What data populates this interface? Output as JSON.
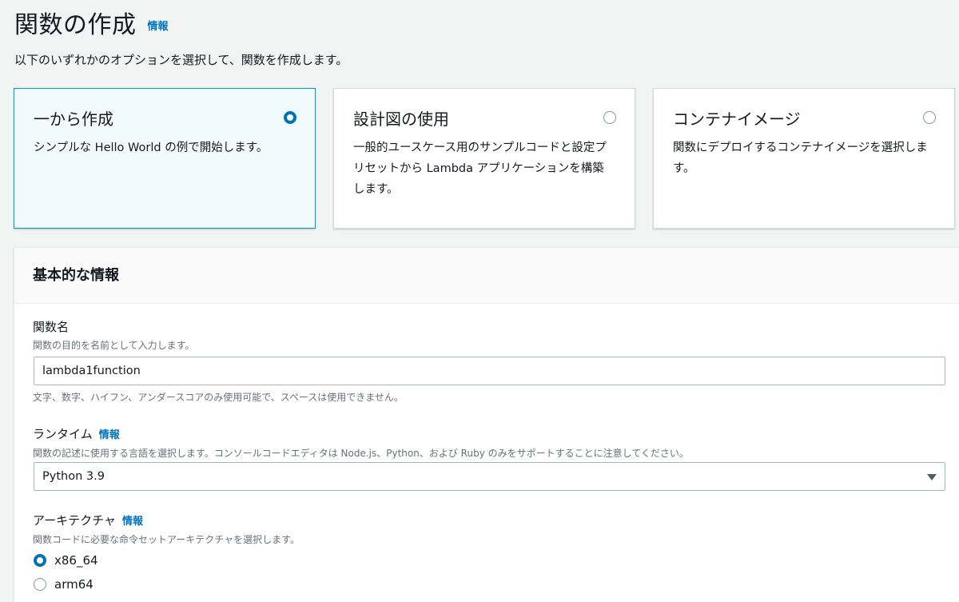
{
  "header": {
    "title": "関数の作成",
    "info_link": "情報",
    "description": "以下のいずれかのオプションを選択して、関数を作成します。"
  },
  "options": [
    {
      "title": "一から作成",
      "description": "シンプルな Hello World の例で開始します。",
      "selected": true
    },
    {
      "title": "設計図の使用",
      "description": "一般的ユースケース用のサンプルコードと設定プリセットから Lambda アプリケーションを構築します。",
      "selected": false
    },
    {
      "title": "コンテナイメージ",
      "description": "関数にデプロイするコンテナイメージを選択します。",
      "selected": false
    }
  ],
  "basic_info": {
    "title": "基本的な情報",
    "function_name": {
      "label": "関数名",
      "description": "関数の目的を名前として入力します。",
      "value": "lambda1function",
      "constraint": "文字、数字、ハイフン、アンダースコアのみ使用可能で、スペースは使用できません。"
    },
    "runtime": {
      "label": "ランタイム",
      "info_link": "情報",
      "description": "関数の記述に使用する言語を選択します。コンソールコードエディタは Node.js、Python、および Ruby のみをサポートすることに注意してください。",
      "selected": "Python 3.9"
    },
    "architecture": {
      "label": "アーキテクチャ",
      "info_link": "情報",
      "description": "関数コードに必要な命令セットアーキテクチャを選択します。",
      "options": [
        {
          "label": "x86_64",
          "selected": true
        },
        {
          "label": "arm64",
          "selected": false
        }
      ]
    }
  },
  "colors": {
    "accent": "#0073bb",
    "selected_border": "#00a1c9",
    "selected_background": "#f1faff",
    "background": "#f2f3f3"
  }
}
